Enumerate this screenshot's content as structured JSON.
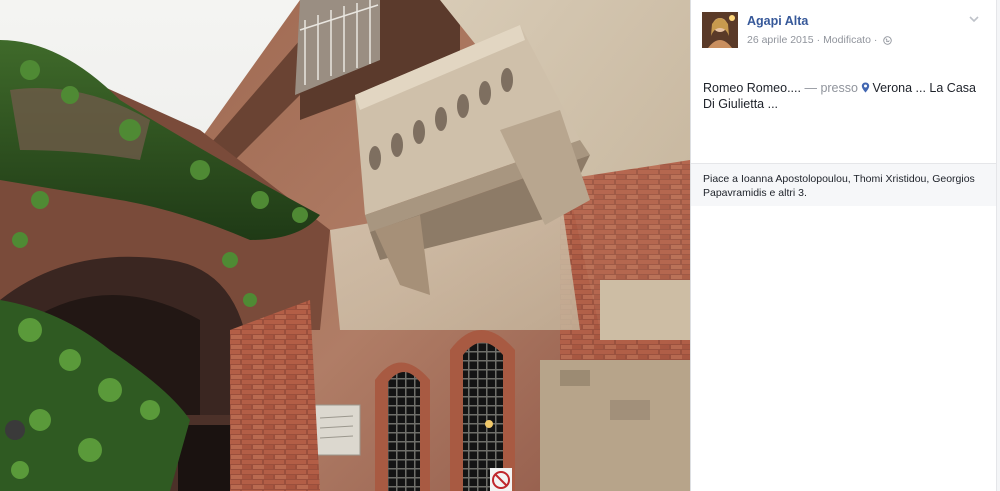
{
  "post": {
    "author_name": "Agapi Alta",
    "date": "26 aprile 2015",
    "separator": "·",
    "edited": "Modificato",
    "privacy_icon": "globe-icon",
    "options_icon": "chevron-down-icon",
    "text": "Romeo Romeo....",
    "with_dash": "—",
    "presso": "presso",
    "location_icon": "map-pin-icon",
    "place": "Verona ... La Casa Di Giulietta ...",
    "likes": "Piace a Ioanna Apostolopoulou, Thomi Xristidou, Georgios Papavramidis e altri 3."
  },
  "photo": {
    "subject": "Juliet's balcony, Verona",
    "sign_icon": "no-entry-sign-icon"
  },
  "colors": {
    "link": "#365899",
    "meta": "#90949c",
    "text": "#1d2129",
    "likes_bg": "#f6f7f9",
    "pin": "#4267b2"
  }
}
